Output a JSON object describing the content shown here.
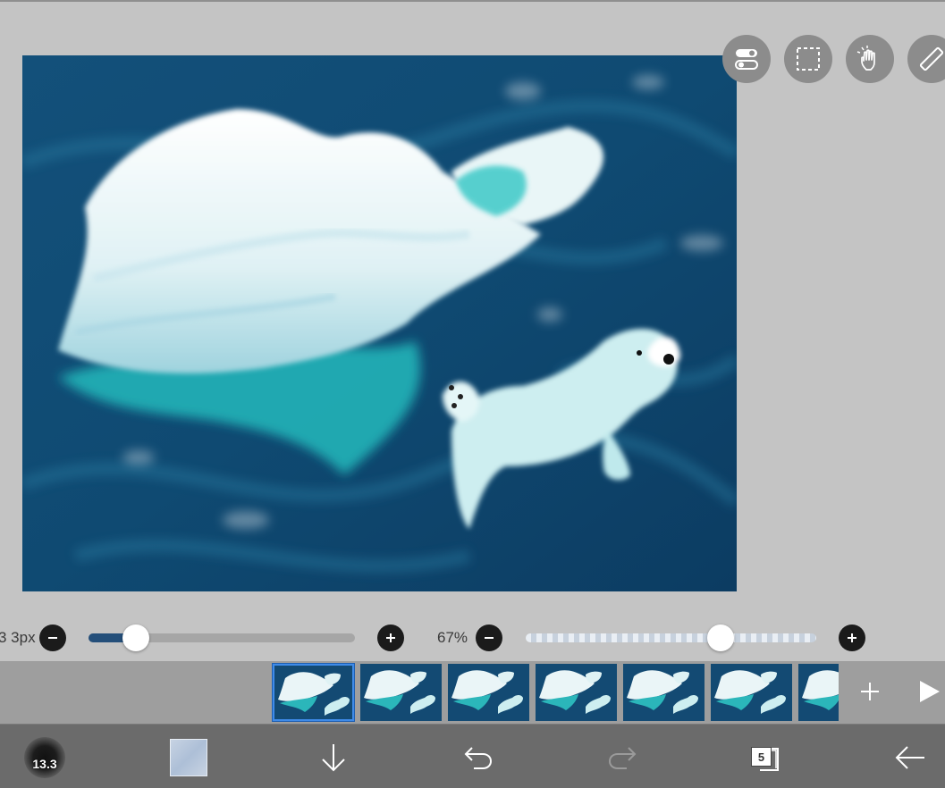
{
  "canvas": {
    "background_color": "#0f3e67"
  },
  "tools": [
    {
      "name": "toggle-icon"
    },
    {
      "name": "selection-icon"
    },
    {
      "name": "hand-icon"
    },
    {
      "name": "ruler-icon"
    }
  ],
  "brush_slider": {
    "value_label": "3 3px",
    "level": 0.1
  },
  "opacity_slider": {
    "value_label": "67%",
    "level": 0.67
  },
  "frames": {
    "count": 7,
    "selected_index": 0
  },
  "toolbar": {
    "brush_size": "13.3",
    "layers_count": "5"
  },
  "colors": {
    "accent": "#3f8be9",
    "toolbar_bg": "#6b6b6b",
    "strip_bg": "#9e9e9e",
    "app_bg": "#c4c4c4",
    "slider_fill": "#244f7a"
  }
}
